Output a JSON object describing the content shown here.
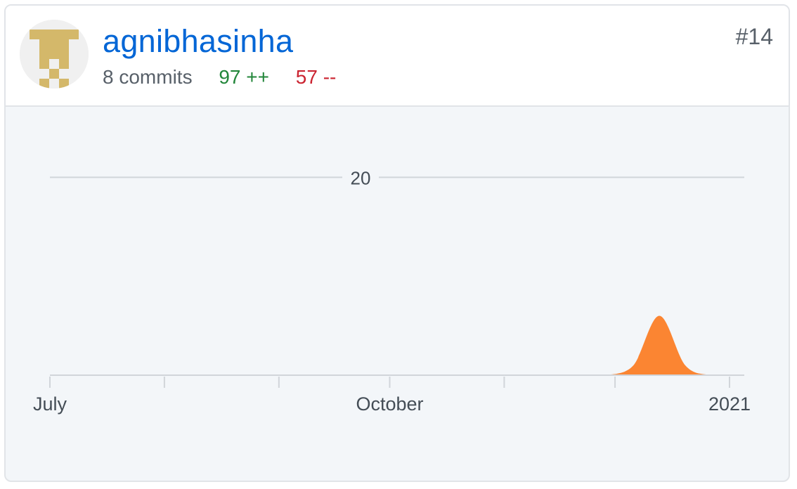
{
  "contributor": {
    "username": "agnibhasinha",
    "commits": "8 commits",
    "additions": "97 ++",
    "deletions": "57 --",
    "rank": "#14",
    "avatar": "identicon-avatar"
  },
  "colors": {
    "link": "#0366d6",
    "additions": "#22863a",
    "deletions": "#cb2431",
    "area": "#fb8532",
    "gridline": "#d1d5da",
    "chart_background": "#f3f6f9"
  },
  "chart_data": {
    "type": "area",
    "y_tick_labels": [
      "20"
    ],
    "y_ticks": [
      20
    ],
    "ylim": [
      0,
      25
    ],
    "x_tick_labels": [
      "July",
      "October",
      "2021"
    ],
    "x_range": [
      "2020-07-01",
      "2021-01-05"
    ],
    "series": [
      {
        "x": [
          "2020-11-29",
          "2020-12-06",
          "2020-12-13",
          "2020-12-20",
          "2020-12-27",
          "2021-01-03"
        ],
        "y": [
          0,
          1,
          6,
          1,
          0,
          0
        ]
      }
    ]
  }
}
